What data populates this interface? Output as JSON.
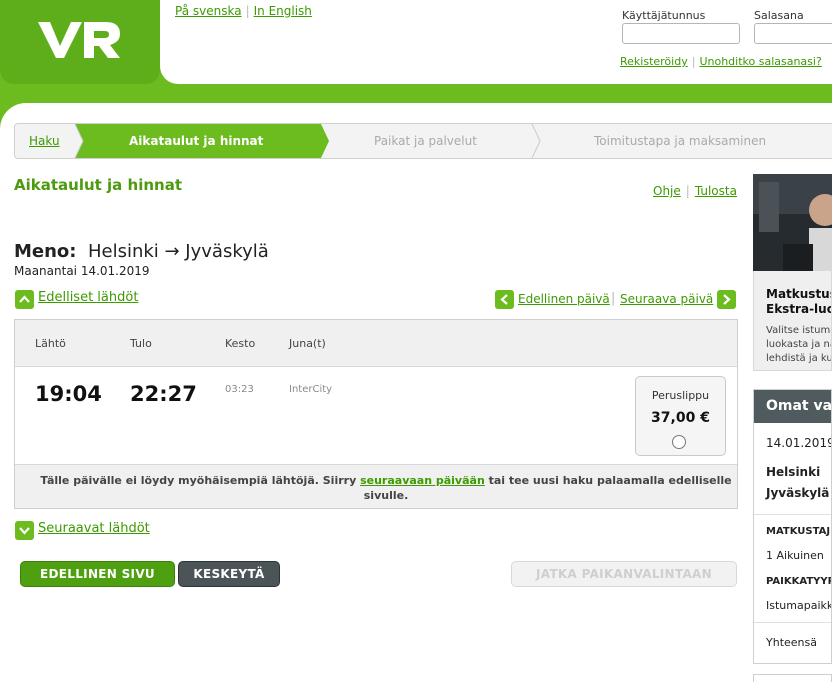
{
  "header": {
    "logo_text": "VR",
    "lang_links": [
      "På svenska",
      "In English"
    ],
    "login": {
      "username_label": "Käyttäjätunnus",
      "password_label": "Salasana",
      "register_link": "Rekisteröidy",
      "forgot_link": "Unohditko salasanasi?"
    }
  },
  "steps": [
    {
      "label": "Haku",
      "state": "done"
    },
    {
      "label": "Aikataulut ja hinnat",
      "state": "active"
    },
    {
      "label": "Paikat ja palvelut",
      "state": "upcoming"
    },
    {
      "label": "Toimitustapa ja maksaminen",
      "state": "upcoming"
    }
  ],
  "main": {
    "title": "Aikataulut ja hinnat",
    "help_links": [
      "Ohje",
      "Tulosta"
    ],
    "direction_label": "Meno:",
    "route": "Helsinki → Jyväskylä",
    "date": "Maanantai 14.01.2019",
    "prev_departures": "Edelliset lähdöt",
    "prev_day": "Edellinen päivä",
    "next_day": "Seuraava päivä",
    "next_departures": "Seuraavat lähdöt"
  },
  "table": {
    "headers": [
      "Lähtö",
      "Tulo",
      "Kesto",
      "Juna(t)"
    ],
    "rows": [
      {
        "departure": "19:04",
        "arrival": "22:27",
        "duration": "03:23",
        "train": "InterCity",
        "fare_name": "Peruslippu",
        "fare_price": "37,00 €",
        "selected": false
      }
    ],
    "note_before": "Tälle päivälle ei löydy myöhäisempiä lähtöjä. Siirry ",
    "note_link": "seuraavaan päivään",
    "note_after": " tai tee uusi haku palaamalla edelliselle sivulle."
  },
  "buttons": {
    "previous": "EDELLINEN SIVU",
    "cancel": "KESKEYTÄ",
    "continue": "JATKA PAIKANVALINTAAN"
  },
  "side": {
    "promo_title_1": "Matkustus",
    "promo_title_2": "Ekstra-luo",
    "promo_text_1": "Valitse istuma",
    "promo_text_2": "luokasta ja na",
    "promo_text_3": "lehdistä ja ku",
    "box_title": "Omat vali",
    "date": "14.01.2019",
    "from": "Helsinki",
    "to": "Jyväskylä",
    "passengers_heading": "MATKUSTAJ",
    "passengers_value": "1 Aikuinen",
    "seat_heading": "PAIKKATYYP",
    "seat_value": "Istumapaikk",
    "total_label": "Yhteensä"
  },
  "colors": {
    "brand_green": "#6cbb1f",
    "link_green": "#3d9a00",
    "dark_button": "#4b5558"
  }
}
